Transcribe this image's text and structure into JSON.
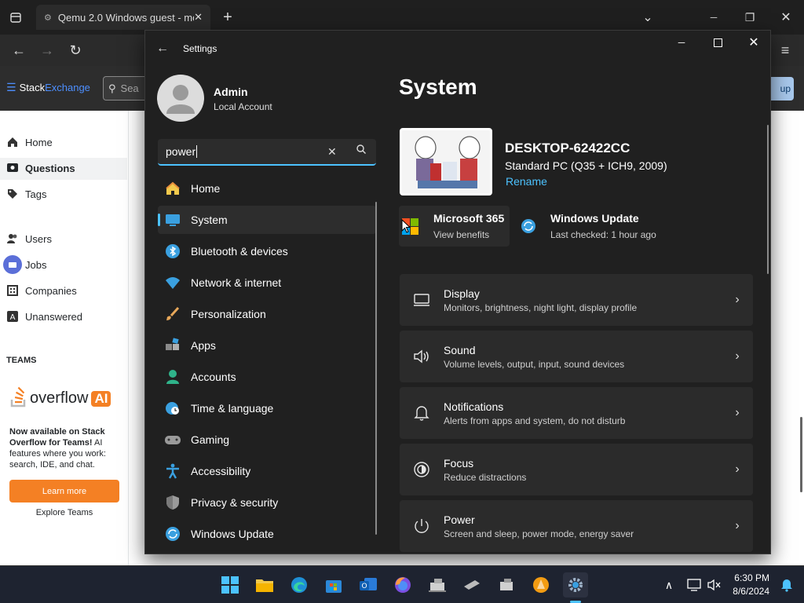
{
  "browser": {
    "tab_title": "Qemu 2.0 Windows guest - mo",
    "new_tab": "+",
    "chevron": "⌄",
    "minimize": "─",
    "maximize": "❐",
    "close": "✕"
  },
  "stackexchange": {
    "logo_text_a": "Stack",
    "logo_text_b": "Exchange",
    "search_placeholder": "Sea",
    "signup_label": "up",
    "nav": {
      "home": "Home",
      "questions": "Questions",
      "tags": "Tags",
      "users": "Users",
      "jobs": "Jobs",
      "companies": "Companies",
      "unanswered": "Unanswered"
    },
    "teams_heading": "TEAMS",
    "overflow_ai_text": "overflow",
    "overflow_ai_badge": "AI",
    "promo_bold": "Now available on Stack Overflow for Teams!",
    "promo_rest": " AI features where you work: search, IDE, and chat.",
    "learn_more": "Learn more",
    "explore_teams": "Explore Teams"
  },
  "settings": {
    "window_title": "Settings",
    "user_name": "Admin",
    "user_type": "Local Account",
    "search_value": "power",
    "page_title": "System",
    "device_name": "DESKTOP-62422CC",
    "device_model": "Standard PC (Q35 + ICH9, 2009)",
    "rename": "Rename",
    "ms365_title": "Microsoft 365",
    "ms365_sub": "View benefits",
    "wu_title": "Windows Update",
    "wu_sub": "Last checked: 1 hour ago",
    "nav": [
      {
        "label": "Home"
      },
      {
        "label": "System"
      },
      {
        "label": "Bluetooth & devices"
      },
      {
        "label": "Network & internet"
      },
      {
        "label": "Personalization"
      },
      {
        "label": "Apps"
      },
      {
        "label": "Accounts"
      },
      {
        "label": "Time & language"
      },
      {
        "label": "Gaming"
      },
      {
        "label": "Accessibility"
      },
      {
        "label": "Privacy & security"
      },
      {
        "label": "Windows Update"
      }
    ],
    "cards": [
      {
        "title": "Display",
        "sub": "Monitors, brightness, night light, display profile"
      },
      {
        "title": "Sound",
        "sub": "Volume levels, output, input, sound devices"
      },
      {
        "title": "Notifications",
        "sub": "Alerts from apps and system, do not disturb"
      },
      {
        "title": "Focus",
        "sub": "Reduce distractions"
      },
      {
        "title": "Power",
        "sub": "Screen and sleep, power mode, energy saver"
      }
    ],
    "accent": "#4cc2ff"
  },
  "taskbar": {
    "time": "6:30 PM",
    "date": "8/6/2024"
  }
}
